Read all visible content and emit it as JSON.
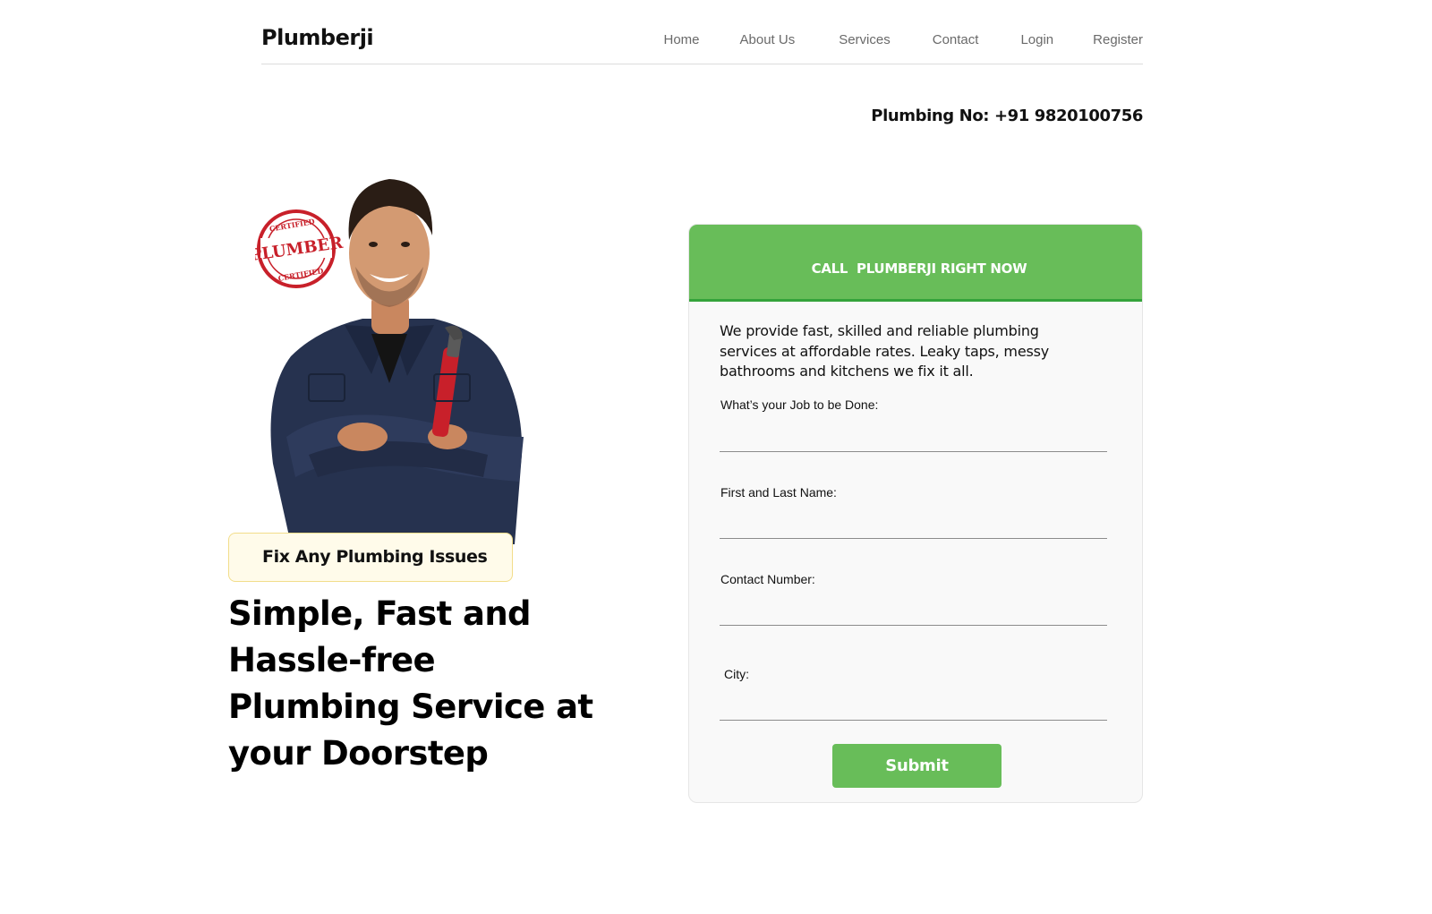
{
  "header": {
    "logo": "Plumberji",
    "nav": [
      "Home",
      "About Us",
      "Services",
      "Contact",
      "Login",
      "Register"
    ]
  },
  "phone_line": "Plumbing No: +91 9820100756",
  "hero": {
    "stamp_text_top": "CERTIFIED",
    "stamp_text_mid": "PLUMBER",
    "stamp_text_bottom": "CERTIFIED",
    "badge": "Fix Any Plumbing Issues",
    "headline": "Simple, Fast and Hassle-free Plumbing Service at your Doorstep"
  },
  "form": {
    "header": "CALL  PLUMBERJI RIGHT NOW",
    "description": "We provide fast, skilled and reliable plumbing services at affordable rates. Leaky taps, messy bathrooms and kitchens we fix it all.",
    "fields": [
      {
        "label": "What’s your Job to be Done:",
        "value": ""
      },
      {
        "label": "First and Last Name:",
        "value": ""
      },
      {
        "label": "Contact Number:",
        "value": ""
      },
      {
        "label": "City:",
        "value": ""
      }
    ],
    "submit": "Submit"
  },
  "colors": {
    "accent_green": "#68bd59",
    "badge_bg": "#fffbea",
    "stamp_red": "#c8202a",
    "uniform_navy": "#26324f"
  }
}
